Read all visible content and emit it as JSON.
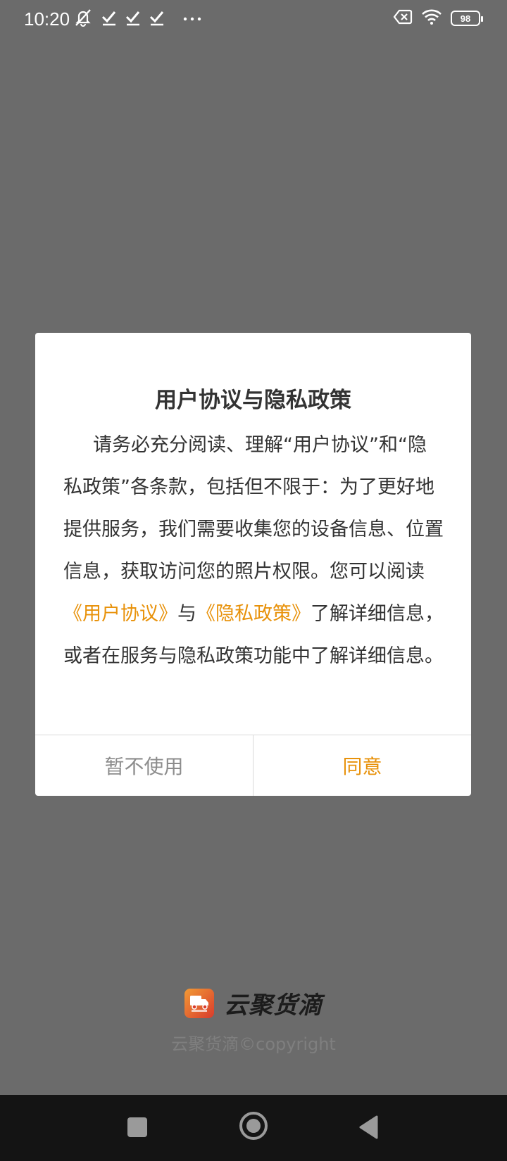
{
  "status_bar": {
    "time": "10:20",
    "battery_level": "98",
    "icons": [
      "mute-icon",
      "check-icon",
      "check-icon",
      "check-icon",
      "more-dots-icon",
      "sim-off-icon",
      "wifi-icon",
      "battery-icon"
    ]
  },
  "dialog": {
    "title": "用户协议与隐私政策",
    "body_part1": "请务必充分阅读、理解“用户协议”和“隐私政策”各条款，包括但不限于：为了更好地提供服务，我们需要收集您的设备信息、位置信息，获取访问您的照片权限。您可以阅读",
    "link_user_agreement": "《用户协议》",
    "body_part2": "与",
    "link_privacy_policy": "《隐私政策》",
    "body_part3": "了解详细信息，或者在服务与隐私政策功能中了解详细信息。",
    "cancel_label": "暂不使用",
    "agree_label": "同意"
  },
  "brand": {
    "name": "云聚货滴",
    "copyright": "云聚货滴©copyright"
  },
  "colors": {
    "accent": "#e8920b",
    "overlay": "#6b6b6b",
    "navbar": "#141414"
  }
}
